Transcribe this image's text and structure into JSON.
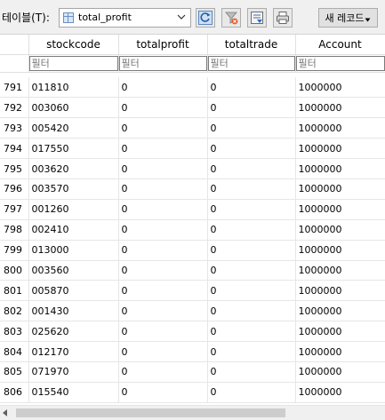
{
  "toolbar": {
    "table_label": "테이블(T):",
    "selected_table": "total_profit",
    "new_record_label": "새 레코드"
  },
  "grid": {
    "columns": [
      "stockcode",
      "totalprofit",
      "totaltrade",
      "Account"
    ],
    "filter_placeholder": "필터",
    "rows": [
      {
        "rownum": "791",
        "stockcode": "011810",
        "totalprofit": "0",
        "totaltrade": "0",
        "account": "1000000"
      },
      {
        "rownum": "792",
        "stockcode": "003060",
        "totalprofit": "0",
        "totaltrade": "0",
        "account": "1000000"
      },
      {
        "rownum": "793",
        "stockcode": "005420",
        "totalprofit": "0",
        "totaltrade": "0",
        "account": "1000000"
      },
      {
        "rownum": "794",
        "stockcode": "017550",
        "totalprofit": "0",
        "totaltrade": "0",
        "account": "1000000"
      },
      {
        "rownum": "795",
        "stockcode": "003620",
        "totalprofit": "0",
        "totaltrade": "0",
        "account": "1000000"
      },
      {
        "rownum": "796",
        "stockcode": "003570",
        "totalprofit": "0",
        "totaltrade": "0",
        "account": "1000000"
      },
      {
        "rownum": "797",
        "stockcode": "001260",
        "totalprofit": "0",
        "totaltrade": "0",
        "account": "1000000"
      },
      {
        "rownum": "798",
        "stockcode": "002410",
        "totalprofit": "0",
        "totaltrade": "0",
        "account": "1000000"
      },
      {
        "rownum": "799",
        "stockcode": "013000",
        "totalprofit": "0",
        "totaltrade": "0",
        "account": "1000000"
      },
      {
        "rownum": "800",
        "stockcode": "003560",
        "totalprofit": "0",
        "totaltrade": "0",
        "account": "1000000"
      },
      {
        "rownum": "801",
        "stockcode": "005870",
        "totalprofit": "0",
        "totaltrade": "0",
        "account": "1000000"
      },
      {
        "rownum": "802",
        "stockcode": "001430",
        "totalprofit": "0",
        "totaltrade": "0",
        "account": "1000000"
      },
      {
        "rownum": "803",
        "stockcode": "025620",
        "totalprofit": "0",
        "totaltrade": "0",
        "account": "1000000"
      },
      {
        "rownum": "804",
        "stockcode": "012170",
        "totalprofit": "0",
        "totaltrade": "0",
        "account": "1000000"
      },
      {
        "rownum": "805",
        "stockcode": "071970",
        "totalprofit": "0",
        "totaltrade": "0",
        "account": "1000000"
      },
      {
        "rownum": "806",
        "stockcode": "015540",
        "totalprofit": "0",
        "totaltrade": "0",
        "account": "1000000"
      }
    ]
  },
  "icons": {
    "table_select": "table-icon",
    "refresh": "refresh-icon",
    "clear_filters": "clear-filter-icon",
    "save": "save-icon",
    "print": "print-icon"
  }
}
